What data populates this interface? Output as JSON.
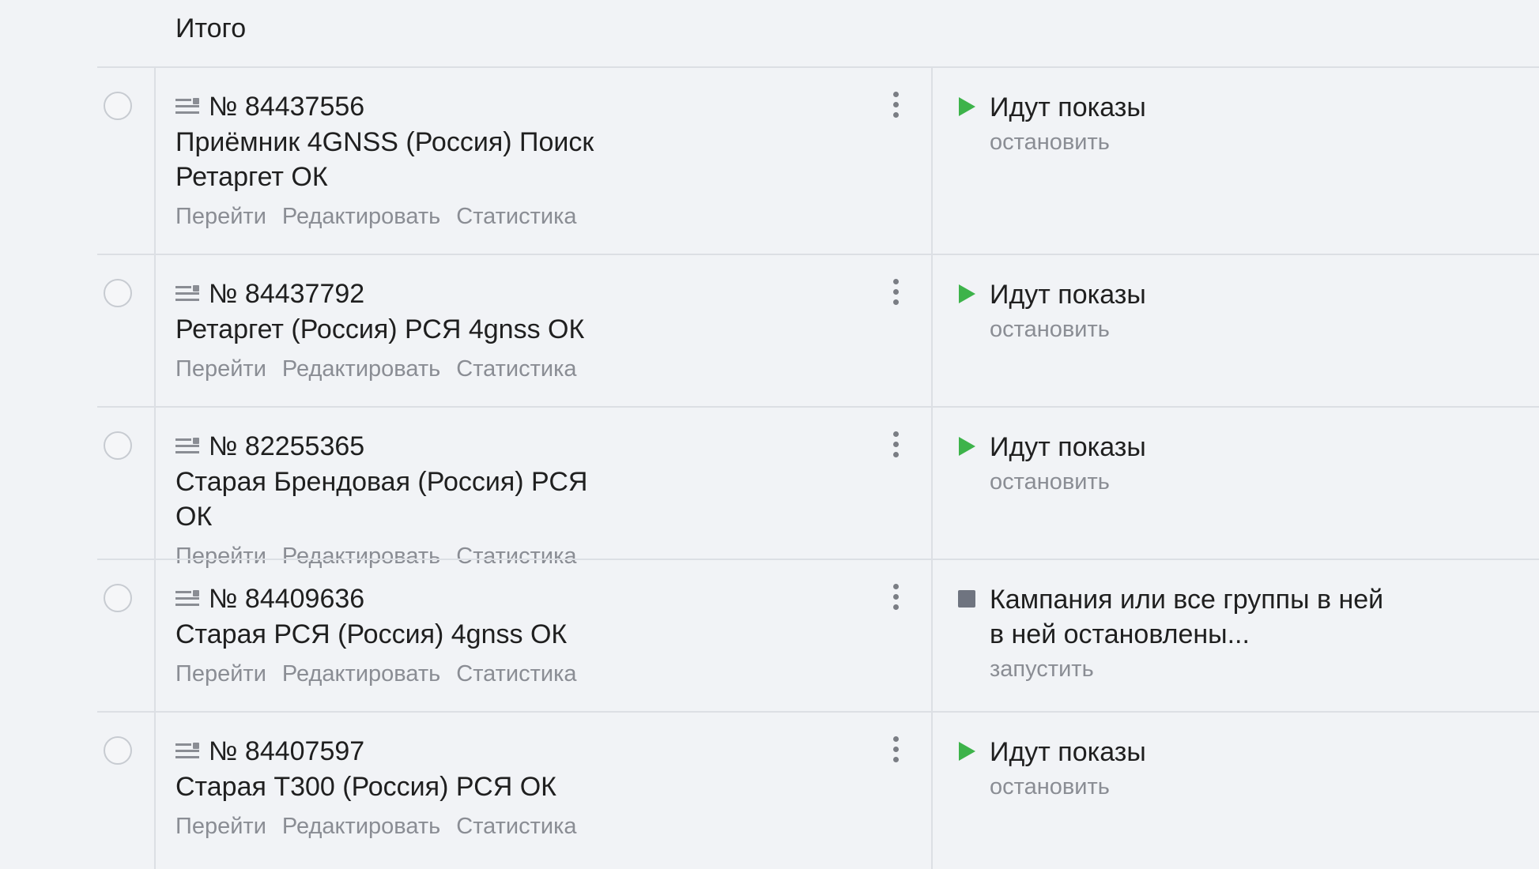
{
  "summary": {
    "total_label": "Итого"
  },
  "actions": {
    "go": "Перейти",
    "edit": "Редактировать",
    "stats": "Статистика"
  },
  "status_colors": {
    "active": "#3db34a",
    "stopped": "#6f7480"
  },
  "campaigns": [
    {
      "id": "№ 84437556",
      "name": "Приёмник 4GNSS (Россия) Поиск Ретаргет ОК",
      "status_icon": "play-icon",
      "status": "Идут показы",
      "status_action": "остановить"
    },
    {
      "id": "№ 84437792",
      "name": "Ретаргет (Россия) РСЯ 4gnss ОК",
      "status_icon": "play-icon",
      "status": "Идут показы",
      "status_action": "остановить"
    },
    {
      "id": "№ 82255365",
      "name": "Старая Брендовая (Россия) РСЯ ОК",
      "status_icon": "play-icon",
      "status": "Идут показы",
      "status_action": "остановить"
    },
    {
      "id": "№ 84409636",
      "name": "Старая РСЯ (Россия) 4gnss ОК",
      "status_icon": "stop-icon",
      "status": "Кампания или все группы в ней в ней остановлены...",
      "status_action": "запустить"
    },
    {
      "id": "№ 84407597",
      "name": "Старая Т300 (Россия) РСЯ ОК",
      "status_icon": "play-icon",
      "status": "Идут показы",
      "status_action": "остановить"
    }
  ]
}
